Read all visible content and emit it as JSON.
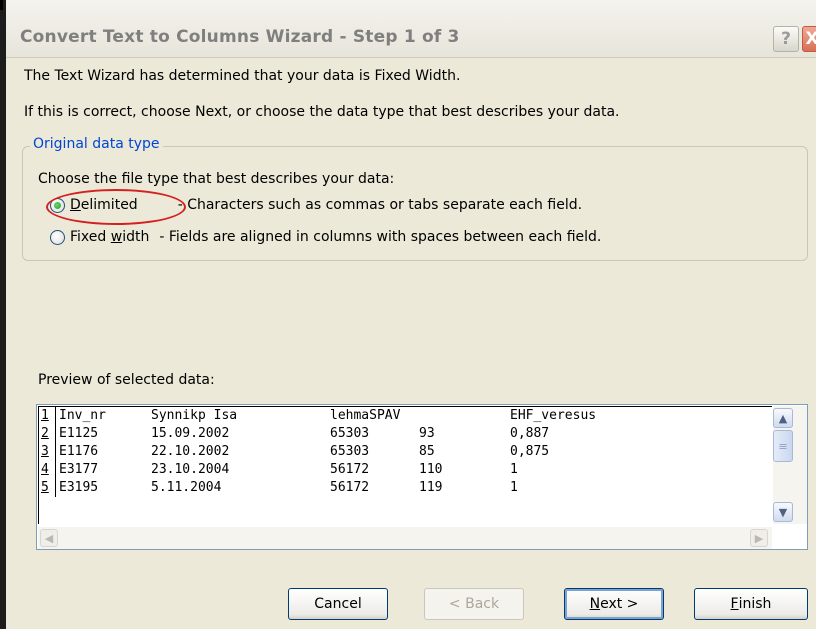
{
  "window": {
    "title": "Convert Text to Columns Wizard - Step 1 of 3"
  },
  "titlebar_buttons": {
    "help": "?",
    "close": "X"
  },
  "intro": {
    "line1": "The Text Wizard has determined that your data is Fixed Width.",
    "line2": "If this is correct, choose Next, or choose the data type that best describes your data."
  },
  "data_type_group": {
    "label": "Original data type",
    "prompt": "Choose the file type that best describes your data:",
    "options": [
      {
        "label_prefix": "",
        "label_accel": "D",
        "label_suffix": "elimited",
        "description": "- Characters such as commas or tabs separate each field.",
        "selected": true
      },
      {
        "label_prefix": "Fixed ",
        "label_accel": "w",
        "label_suffix": "idth",
        "description": "- Fields are aligned in columns with spaces between each field.",
        "selected": false
      }
    ]
  },
  "preview": {
    "label": "Preview of selected data:",
    "rows": [
      {
        "num": "1",
        "c1": "Inv_nr",
        "c2": "Synnikp Isa",
        "c3": "lehmaSPAV",
        "c4": "",
        "c5": "EHF_veresus"
      },
      {
        "num": "2",
        "c1": "E1125",
        "c2": "15.09.2002",
        "c3": "65303",
        "c4": "93",
        "c5": "0,887"
      },
      {
        "num": "3",
        "c1": "E1176",
        "c2": "22.10.2002",
        "c3": "65303",
        "c4": "85",
        "c5": "0,875"
      },
      {
        "num": "4",
        "c1": "E3177",
        "c2": "23.10.2004",
        "c3": "56172",
        "c4": "110",
        "c5": "1"
      },
      {
        "num": "5",
        "c1": "E3195",
        "c2": "5.11.2004",
        "c3": "56172",
        "c4": "119",
        "c5": "1"
      }
    ]
  },
  "buttons": {
    "cancel": "Cancel",
    "back": "< Back",
    "next_accel": "N",
    "next_rest": "ext >",
    "finish_accel": "F",
    "finish_rest": "inish"
  },
  "icons": {
    "scroll_up": "up-arrow",
    "scroll_down": "down-arrow",
    "scroll_left": "left-arrow",
    "scroll_right": "right-arrow"
  },
  "colors": {
    "group_label": "#0046d5",
    "annotation": "#d62020",
    "dialog_bg": "#ece9d8"
  }
}
